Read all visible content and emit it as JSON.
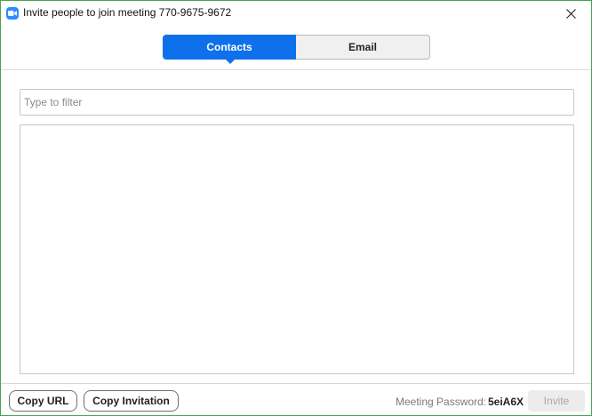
{
  "window": {
    "title": "Invite people to join meeting 770-9675-9672",
    "app_icon": "zoom-camera-icon",
    "close_icon": "close-icon"
  },
  "tabs": [
    {
      "label": "Contacts",
      "selected": true
    },
    {
      "label": "Email",
      "selected": false
    }
  ],
  "filter": {
    "placeholder": "Type to filter",
    "value": ""
  },
  "contacts": [],
  "footer": {
    "copy_url_label": "Copy URL",
    "copy_invitation_label": "Copy Invitation",
    "password_label": "Meeting Password:",
    "password_value": "5eiA6X",
    "invite_label": "Invite",
    "invite_enabled": false
  },
  "colors": {
    "accent": "#0e71eb",
    "window_border": "#4ea34e",
    "app_icon_bg": "#2d8cff"
  }
}
